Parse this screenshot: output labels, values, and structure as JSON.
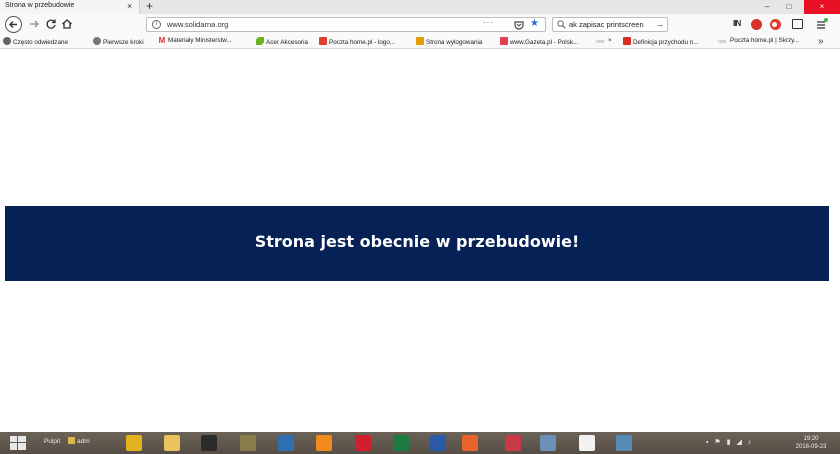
{
  "browser": {
    "tab_title": "Strona w przebudowie",
    "tab_close": "×",
    "new_tab": "+",
    "window_controls": {
      "minimize": "–",
      "maximize": "□",
      "close": "×"
    },
    "url": "www.solidarna.org",
    "page_actions": "···",
    "search_value": "ak zapisac printscreen",
    "search_go": "→",
    "library_icon": "IIN",
    "bookmarks_more": "»"
  },
  "bookmarks": [
    {
      "label": "Często odwiedzane",
      "icon": "gear-icon",
      "color": "#555555"
    },
    {
      "label": "Pierwsze kroki",
      "icon": "firefox-icon",
      "color": "#555555"
    },
    {
      "label": "Materiały Ministerstw...",
      "icon": "gmail-icon",
      "color": "#d93025"
    },
    {
      "label": "Acer Akcesoria",
      "icon": "leaf-icon",
      "color": "#6ab023"
    },
    {
      "label": "Poczta home.pl - logo...",
      "icon": "mail-icon",
      "color": "#e04030"
    },
    {
      "label": "Strona wylogowania",
      "icon": "grid-icon",
      "color": "#e0a000"
    },
    {
      "label": "www.Gazeta.pl - Polsk...",
      "icon": "gazeta-icon",
      "color": "#e04050"
    },
    {
      "label": "×",
      "icon": "dots-icon",
      "color": "#999999"
    },
    {
      "label": "Definicja przychodu n...",
      "icon": "pdf-icon",
      "color": "#d93025"
    },
    {
      "label": "Poczta home.pl | Skrzy...",
      "icon": "dots-icon",
      "color": "#999999"
    }
  ],
  "page": {
    "banner_text": "Strona jest obecnie w przebudowie!",
    "banner_color": "#062155"
  },
  "taskbar": {
    "pulpit": "Pulpit",
    "user": "adm",
    "clock_time": "19:20",
    "clock_date": "2018-09-23",
    "apps": [
      {
        "name": "chrome-icon",
        "color": "#e3b21c"
      },
      {
        "name": "folder-icon",
        "color": "#e9c45a"
      },
      {
        "name": "media-icon",
        "color": "#2b2b2b"
      },
      {
        "name": "people-icon",
        "color": "#8a7d4c"
      },
      {
        "name": "app-icon",
        "color": "#2f6fb0"
      },
      {
        "name": "vlc-icon",
        "color": "#f08a1c"
      },
      {
        "name": "opera-icon",
        "color": "#d02030"
      },
      {
        "name": "excel-icon",
        "color": "#1f7a3f"
      },
      {
        "name": "word-icon",
        "color": "#2a5aa8"
      },
      {
        "name": "firefox-icon",
        "color": "#e6632a"
      },
      {
        "name": "paint-icon",
        "color": "#c83a4a"
      },
      {
        "name": "network-icon",
        "color": "#6a8fb8"
      },
      {
        "name": "notepad-icon",
        "color": "#f2f2f2"
      },
      {
        "name": "palette-icon",
        "color": "#5a8ab8"
      }
    ]
  }
}
